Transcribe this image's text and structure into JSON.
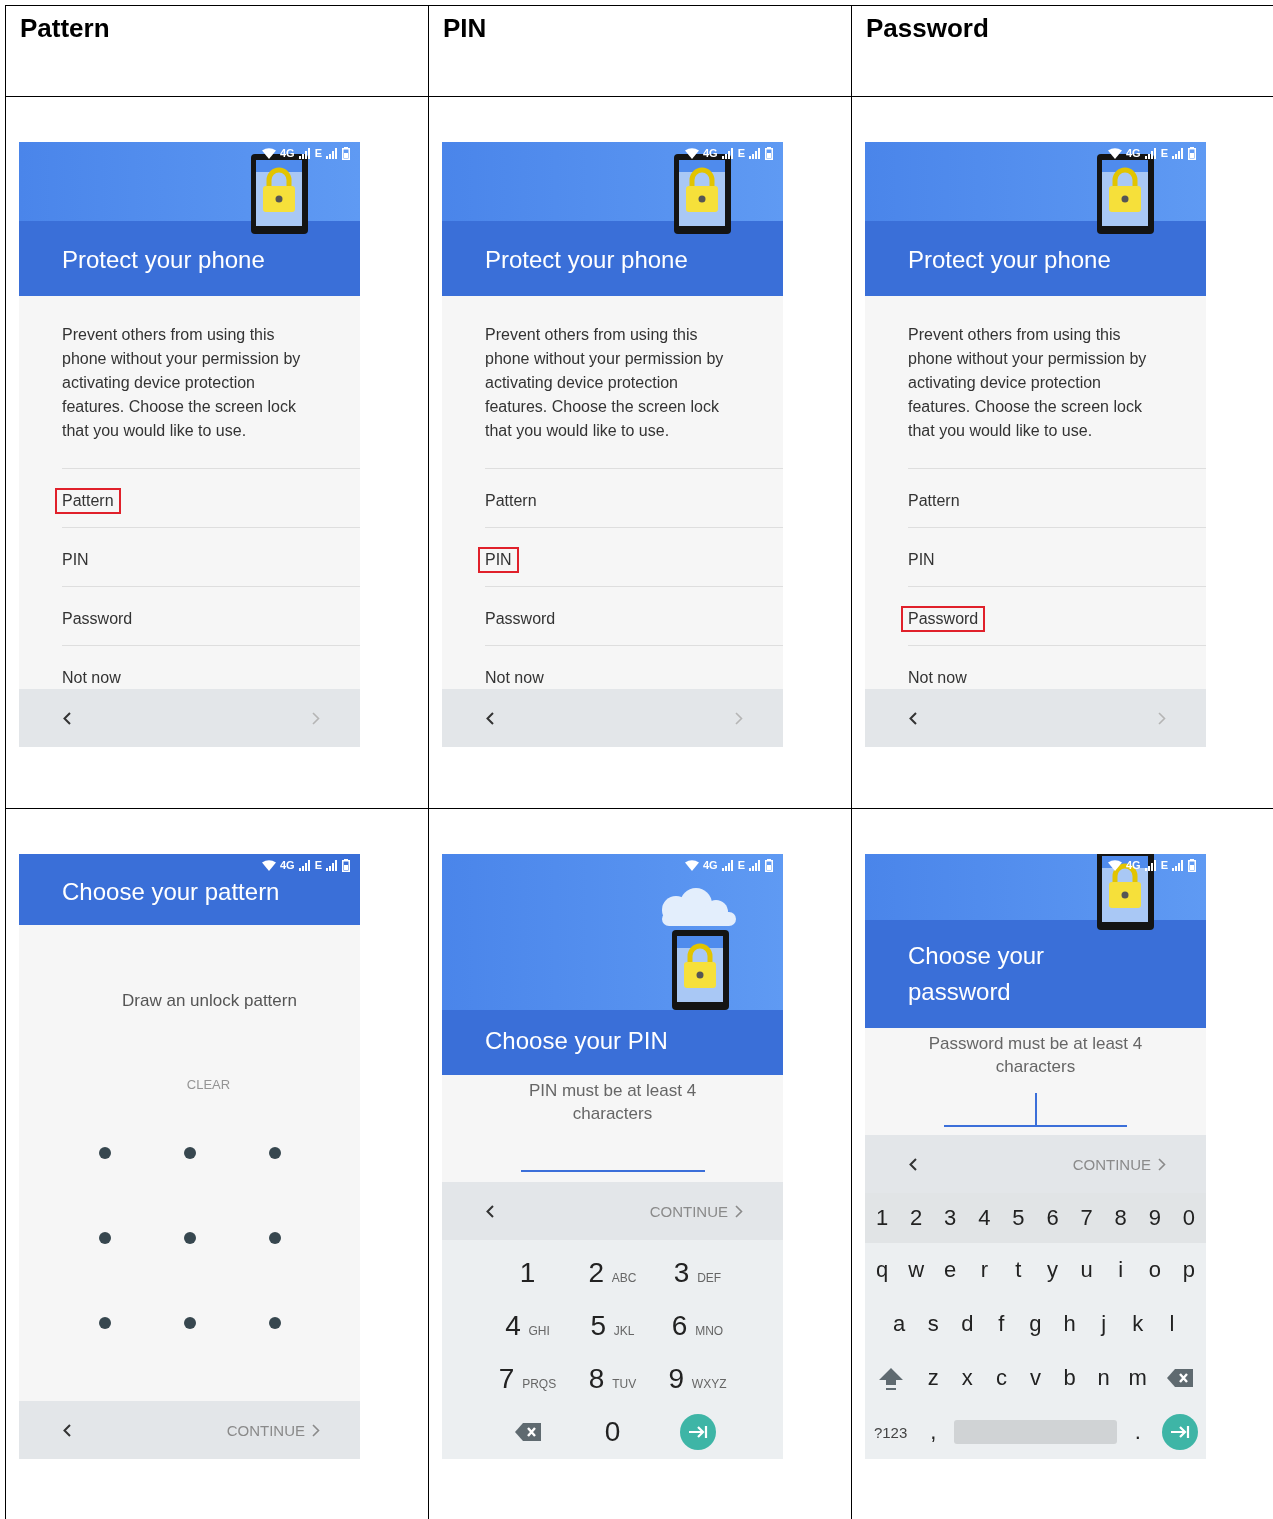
{
  "table": {
    "columns": [
      "Pattern",
      "PIN",
      "Password"
    ],
    "rows": [
      {
        "cells": [
          {
            "kind": "choose_lock",
            "status_bar": {
              "network": "4G",
              "network_2": "E"
            },
            "title": "Protect your phone",
            "description": "Prevent others from using this phone without your permission by activating device protection features. Choose the screen lock that you would like to use.",
            "options": [
              {
                "label": "Pattern",
                "highlighted": true
              },
              {
                "label": "PIN",
                "highlighted": false
              },
              {
                "label": "Password",
                "highlighted": false
              },
              {
                "label": "Not now",
                "highlighted": false
              }
            ]
          },
          {
            "kind": "choose_lock",
            "status_bar": {
              "network": "4G",
              "network_2": "E"
            },
            "title": "Protect your phone",
            "description": "Prevent others from using this phone without your permission by activating device protection features. Choose the screen lock that you would like to use.",
            "options": [
              {
                "label": "Pattern",
                "highlighted": false
              },
              {
                "label": "PIN",
                "highlighted": true
              },
              {
                "label": "Password",
                "highlighted": false
              },
              {
                "label": "Not now",
                "highlighted": false
              }
            ]
          },
          {
            "kind": "choose_lock",
            "status_bar": {
              "network": "4G",
              "network_2": "E"
            },
            "title": "Protect your phone",
            "description": "Prevent others from using this phone without your permission by activating device protection features. Choose the screen lock that you would like to use.",
            "options": [
              {
                "label": "Pattern",
                "highlighted": false
              },
              {
                "label": "PIN",
                "highlighted": false
              },
              {
                "label": "Password",
                "highlighted": true
              },
              {
                "label": "Not now",
                "highlighted": false
              }
            ]
          }
        ]
      },
      {
        "cells": [
          {
            "kind": "pattern",
            "status_bar": {
              "network": "4G",
              "network_2": "E"
            },
            "title": "Choose your pattern",
            "instruction": "Draw an unlock pattern",
            "clear": {
              "label": "CLEAR",
              "disabled": true
            },
            "continue": {
              "label": "CONTINUE",
              "disabled": true
            }
          },
          {
            "kind": "pin",
            "status_bar": {
              "network": "4G",
              "network_2": "E"
            },
            "title": "Choose your PIN",
            "hint": "PIN must be at least 4 characters",
            "continue": {
              "label": "CONTINUE",
              "disabled": true
            },
            "keys": [
              {
                "kind": "digit",
                "label": "1"
              },
              {
                "kind": "digit",
                "label": "2",
                "letters": "ABC"
              },
              {
                "kind": "digit",
                "label": "3",
                "letters": "DEF"
              },
              {
                "kind": "digit",
                "label": "4",
                "letters": "GHI"
              },
              {
                "kind": "digit",
                "label": "5",
                "letters": "JKL"
              },
              {
                "kind": "digit",
                "label": "6",
                "letters": "MNO"
              },
              {
                "kind": "digit",
                "label": "7",
                "letters": "PRQS"
              },
              {
                "kind": "digit",
                "label": "8",
                "letters": "TUV"
              },
              {
                "kind": "digit",
                "label": "9",
                "letters": "WXYZ"
              },
              {
                "kind": "backspace"
              },
              {
                "kind": "digit",
                "label": "0"
              },
              {
                "kind": "enter"
              }
            ]
          },
          {
            "kind": "password",
            "status_bar": {
              "network": "4G",
              "network_2": "E"
            },
            "title": "Choose your password",
            "hint": "Password must be at least 4 characters",
            "continue": {
              "label": "CONTINUE",
              "disabled": true
            },
            "keyboard": [
              {
                "keys": [
                  {
                    "kind": "char",
                    "label": "1"
                  },
                  {
                    "kind": "char",
                    "label": "2"
                  },
                  {
                    "kind": "char",
                    "label": "3"
                  },
                  {
                    "kind": "char",
                    "label": "4"
                  },
                  {
                    "kind": "char",
                    "label": "5"
                  },
                  {
                    "kind": "char",
                    "label": "6"
                  },
                  {
                    "kind": "char",
                    "label": "7"
                  },
                  {
                    "kind": "char",
                    "label": "8"
                  },
                  {
                    "kind": "char",
                    "label": "9"
                  },
                  {
                    "kind": "char",
                    "label": "0"
                  }
                ]
              },
              {
                "keys": [
                  {
                    "kind": "char",
                    "label": "q"
                  },
                  {
                    "kind": "char",
                    "label": "w"
                  },
                  {
                    "kind": "char",
                    "label": "e"
                  },
                  {
                    "kind": "char",
                    "label": "r"
                  },
                  {
                    "kind": "char",
                    "label": "t"
                  },
                  {
                    "kind": "char",
                    "label": "y"
                  },
                  {
                    "kind": "char",
                    "label": "u"
                  },
                  {
                    "kind": "char",
                    "label": "i"
                  },
                  {
                    "kind": "char",
                    "label": "o"
                  },
                  {
                    "kind": "char",
                    "label": "p"
                  }
                ]
              },
              {
                "keys": [
                  {
                    "kind": "char",
                    "label": "a"
                  },
                  {
                    "kind": "char",
                    "label": "s"
                  },
                  {
                    "kind": "char",
                    "label": "d"
                  },
                  {
                    "kind": "char",
                    "label": "f"
                  },
                  {
                    "kind": "char",
                    "label": "g"
                  },
                  {
                    "kind": "char",
                    "label": "h"
                  },
                  {
                    "kind": "char",
                    "label": "j"
                  },
                  {
                    "kind": "char",
                    "label": "k"
                  },
                  {
                    "kind": "char",
                    "label": "l"
                  }
                ]
              },
              {
                "keys": [
                  {
                    "kind": "shift"
                  },
                  {
                    "kind": "char",
                    "label": "z"
                  },
                  {
                    "kind": "char",
                    "label": "x"
                  },
                  {
                    "kind": "char",
                    "label": "c"
                  },
                  {
                    "kind": "char",
                    "label": "v"
                  },
                  {
                    "kind": "char",
                    "label": "b"
                  },
                  {
                    "kind": "char",
                    "label": "n"
                  },
                  {
                    "kind": "char",
                    "label": "m"
                  },
                  {
                    "kind": "backspace"
                  }
                ]
              },
              {
                "keys": [
                  {
                    "kind": "mode",
                    "label": "?123"
                  },
                  {
                    "kind": "char",
                    "label": ","
                  },
                  {
                    "kind": "space"
                  },
                  {
                    "kind": "char",
                    "label": "."
                  },
                  {
                    "kind": "enter"
                  }
                ]
              }
            ]
          }
        ]
      }
    ]
  }
}
